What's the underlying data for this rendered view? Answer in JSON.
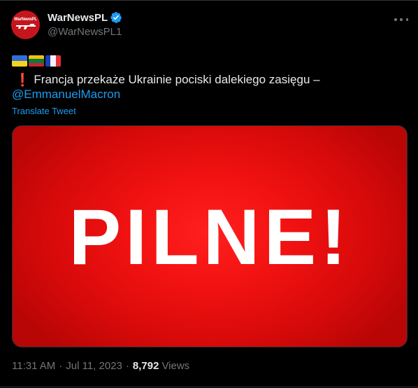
{
  "author": {
    "display_name": "WarNewsPL",
    "handle": "@WarNewsPL1",
    "avatar_text": "WarNewsPL",
    "verified": true
  },
  "tweet": {
    "flags": [
      "flag-ukraine",
      "flag-lithuania",
      "flag-france"
    ],
    "exclaim_glyph": "❗",
    "text": "Francja przekaże Ukrainie pociski dalekiego zasięgu –",
    "mention": "@EmmanuelMacron",
    "translate_label": "Translate Tweet",
    "media_text": "PILNE!"
  },
  "meta": {
    "time": "11:31 AM",
    "separator": "·",
    "date": "Jul 11, 2023",
    "views_count": "8,792",
    "views_label": "Views"
  },
  "colors": {
    "background": "#000000",
    "link": "#1d9bf0",
    "muted": "#71767b",
    "media_red": "#e50f0f"
  }
}
